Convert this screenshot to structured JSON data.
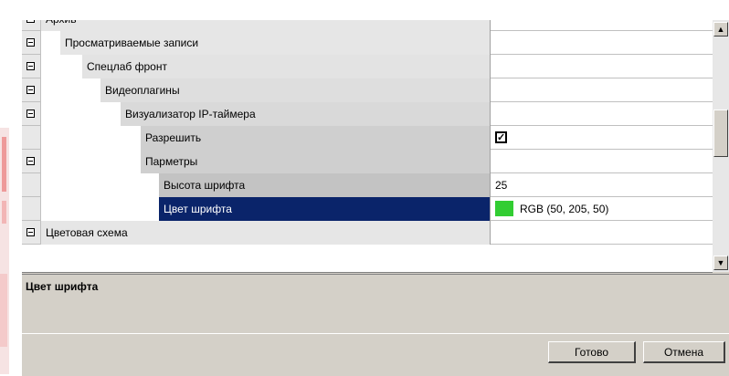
{
  "grid": {
    "rows": [
      {
        "expander": true,
        "name": "Архив",
        "value": ""
      },
      {
        "expander": true,
        "name": "Просматриваемые записи",
        "value": ""
      },
      {
        "expander": true,
        "name": "Спецлаб фронт",
        "value": ""
      },
      {
        "expander": true,
        "name": "Видеоплагины",
        "value": ""
      },
      {
        "expander": true,
        "name": "Визуализатор IP-таймера",
        "value": ""
      },
      {
        "expander": false,
        "name": "Разрешить",
        "value_type": "checkbox",
        "checked": true,
        "checkmark": "✓"
      },
      {
        "expander": true,
        "name": "Парметры",
        "value": ""
      },
      {
        "expander": false,
        "name": "Высота шрифта",
        "value": "25"
      },
      {
        "expander": false,
        "name": "Цвет шрифта",
        "value_type": "color",
        "value": "RGB (50, 205, 50)",
        "color": "#32cd32",
        "selected": true
      },
      {
        "expander": true,
        "name": "Цветовая схема",
        "value": ""
      }
    ]
  },
  "scrollbar": {
    "up_icon": "▲",
    "down_icon": "▼"
  },
  "description": {
    "title": "Цвет шрифта"
  },
  "buttons": {
    "ok_label": "Готово",
    "cancel_label": "Отмена"
  },
  "colors": {
    "selection": "#0a246a",
    "dialog_bg": "#d4d0c8"
  }
}
